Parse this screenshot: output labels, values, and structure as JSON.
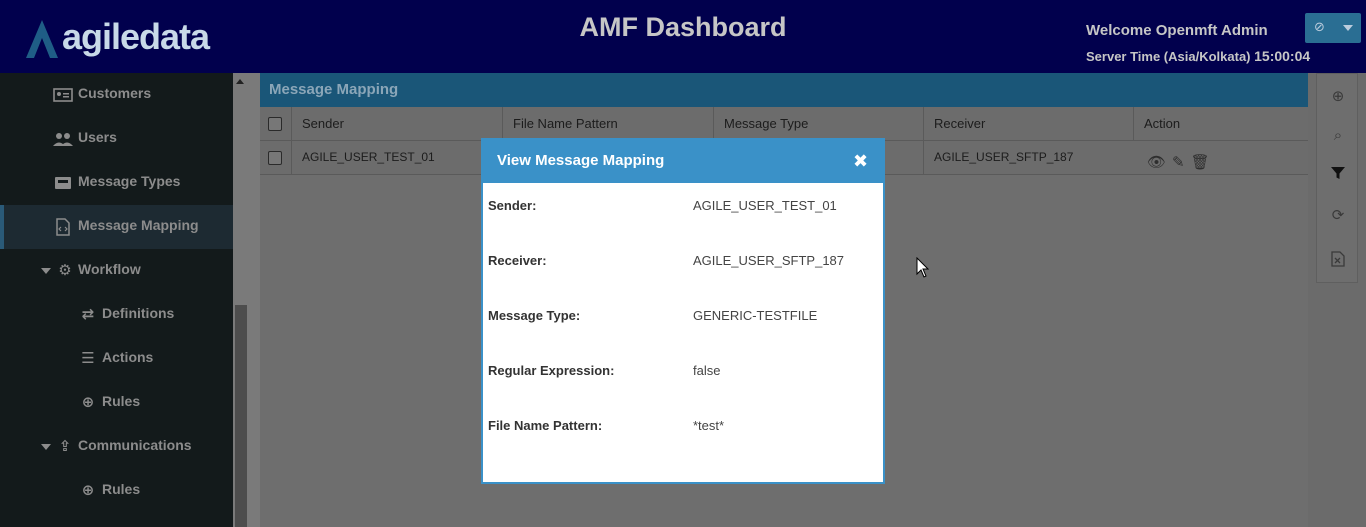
{
  "header": {
    "logo_text": "agiledata",
    "title": "AMF Dashboard",
    "welcome": "Welcome Openmft Admin",
    "server_time_label": "Server Time (Asia/Kolkata)",
    "server_time_value": "15:00:04"
  },
  "sidebar": {
    "items": [
      {
        "label": "Customers",
        "icon": "id-card-icon"
      },
      {
        "label": "Users",
        "icon": "users-icon"
      },
      {
        "label": "Message Types",
        "icon": "envelope-icon"
      },
      {
        "label": "Message Mapping",
        "icon": "code-file-icon",
        "active": true
      },
      {
        "label": "Workflow",
        "icon": "gear-icon"
      },
      {
        "label": "Definitions",
        "icon": "exchange-icon"
      },
      {
        "label": "Actions",
        "icon": "list-icon"
      },
      {
        "label": "Rules",
        "icon": "circle-down-icon"
      },
      {
        "label": "Communications",
        "icon": "share-icon"
      },
      {
        "label": "Rules",
        "icon": "circle-down-icon"
      }
    ]
  },
  "main": {
    "title": "Message Mapping",
    "columns": [
      "Sender",
      "File Name Pattern",
      "Message Type",
      "Receiver",
      "Action"
    ],
    "rows": [
      {
        "sender": "AGILE_USER_TEST_01",
        "receiver": "AGILE_USER_SFTP_187"
      }
    ]
  },
  "modal": {
    "title": "View Message Mapping",
    "fields": [
      {
        "label": "Sender:",
        "value": "AGILE_USER_TEST_01"
      },
      {
        "label": "Receiver:",
        "value": "AGILE_USER_SFTP_187"
      },
      {
        "label": "Message Type:",
        "value": "GENERIC-TESTFILE"
      },
      {
        "label": "Regular Expression:",
        "value": "false"
      },
      {
        "label": "File Name Pattern:",
        "value": "*test*"
      }
    ]
  },
  "colors": {
    "header_bg": "#01004d",
    "modal_accent": "#3a91c8",
    "panel_title_bg": "#1a5678"
  }
}
